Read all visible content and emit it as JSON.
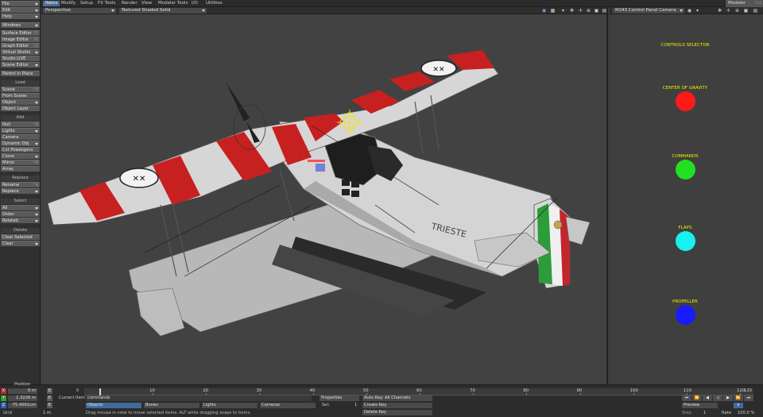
{
  "toolbar": {
    "file": "File",
    "edit": "Edit",
    "help": "Help",
    "windows": "Windows",
    "surface_editor": "Surface Editor",
    "surface_editor_sc": "F5",
    "image_editor": "Image Editor",
    "image_editor_sc": "F6",
    "graph_editor": "Graph Editor",
    "graph_editor_sc": "F2",
    "virtual_studio": "Virtual Studio",
    "studio_live": "Studio LIVE",
    "scene_editor": "Scene Editor",
    "parent_in_place": "Parent in Place",
    "load_header": "Load",
    "scene": "Scene",
    "scene_sc": "^O",
    "from_scene": "From Scene",
    "object": "Object",
    "object_layer": "Object Layer",
    "add_header": "Add",
    "null": "Null",
    "null_sc": "^N",
    "lights": "Lights",
    "camera": "Camera",
    "dynamic_obj": "Dynamic Obj",
    "cvt_powergons": "Cvt Powergons",
    "clone": "Clone",
    "mirror": "Mirror",
    "mirror_sc": "^M",
    "array": "Array",
    "replace_header": "Replace",
    "rename": "Rename",
    "rename_sc": "^N",
    "replace": "Replace",
    "select_header": "Select",
    "all": "All",
    "order": "Order",
    "related": "Related",
    "delete_header": "Delete",
    "clear_selected": "Clear Selected",
    "clear": "Clear"
  },
  "tabs": [
    "Items",
    "Modify",
    "Setup",
    "FX Tools",
    "Render",
    "View",
    "Modeler Tools",
    "I/O",
    "Utilities"
  ],
  "modeler": "Modeler",
  "modeler_sc": "F12",
  "viewport1": {
    "view": "Perspective",
    "shading": "Textured Shaded Solid",
    "fuselage_text": "TRIESTE"
  },
  "viewport2": {
    "camera": "RO43 Control Panel Camera",
    "controls": [
      {
        "label": "CONTROLS SELECTOR",
        "color": ""
      },
      {
        "label": "CENTER OF GRAVITY",
        "color": "#ff1a1a"
      },
      {
        "label": "COMMANDS",
        "color": "#22e022"
      },
      {
        "label": "FLAPS",
        "color": "#19f0f0"
      },
      {
        "label": "PROPELLER",
        "color": "#1a1aff"
      }
    ]
  },
  "bottom": {
    "position_label": "Position",
    "x_axis": "X",
    "y_axis": "Y",
    "z_axis": "Z",
    "x_value": "0 m",
    "y_value": "1.3226 m",
    "z_value": "-75.4001cm",
    "grid_label": "Grid",
    "grid_value": "1 m",
    "current_item_label": "Current Item",
    "current_item": "commands",
    "objects": "Objects",
    "bones": "Bones",
    "lights": "Lights",
    "cameras": "Cameras",
    "properties": "Properties",
    "sel_label": "Sel:",
    "sel_value": "1",
    "auto_key": "Auto Key: All Channels",
    "create_key": "Create Key",
    "delete_key": "Delete Key",
    "status": "Drag mouse in view to move selected items. ALT while dragging snaps to items.",
    "timeline_ticks": [
      "0",
      "10",
      "20",
      "30",
      "40",
      "50",
      "60",
      "70",
      "80",
      "90",
      "100",
      "110",
      "120"
    ],
    "frame_start": "0",
    "frame_end": "120",
    "frame_end2": "120",
    "preview": "Preview",
    "step": "Step",
    "step_value": "1",
    "rate_label": "Rate",
    "rate_value": "100.0 %"
  }
}
